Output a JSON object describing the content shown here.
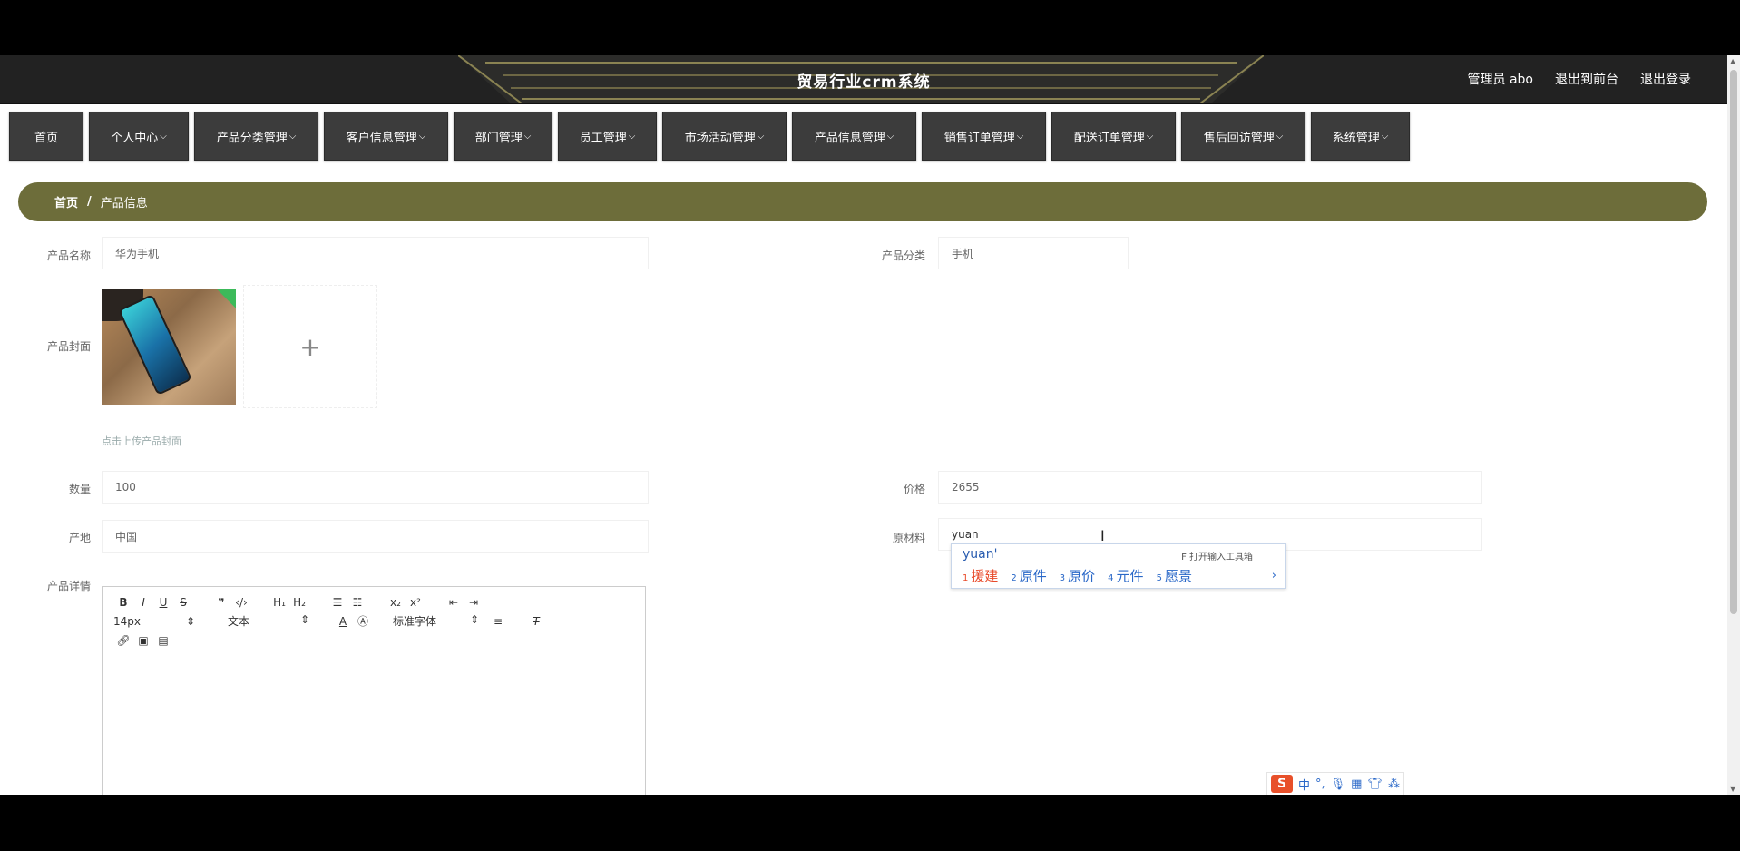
{
  "header": {
    "title": "贸易行业crm系统",
    "user_label": "管理员 abo",
    "back_to_front": "退出到前台",
    "logout": "退出登录"
  },
  "nav": [
    {
      "label": "首页",
      "has_dropdown": false
    },
    {
      "label": "个人中心",
      "has_dropdown": true
    },
    {
      "label": "产品分类管理",
      "has_dropdown": true
    },
    {
      "label": "客户信息管理",
      "has_dropdown": true
    },
    {
      "label": "部门管理",
      "has_dropdown": true
    },
    {
      "label": "员工管理",
      "has_dropdown": true
    },
    {
      "label": "市场活动管理",
      "has_dropdown": true
    },
    {
      "label": "产品信息管理",
      "has_dropdown": true
    },
    {
      "label": "销售订单管理",
      "has_dropdown": true
    },
    {
      "label": "配送订单管理",
      "has_dropdown": true
    },
    {
      "label": "售后回访管理",
      "has_dropdown": true
    },
    {
      "label": "系统管理",
      "has_dropdown": true
    }
  ],
  "breadcrumb": {
    "home": "首页",
    "separator": "/",
    "current": "产品信息"
  },
  "form": {
    "name_label": "产品名称",
    "name_value": "华为手机",
    "category_label": "产品分类",
    "category_value": "手机",
    "cover_label": "产品封面",
    "cover_hint": "点击上传产品封面",
    "quantity_label": "数量",
    "quantity_value": "100",
    "price_label": "价格",
    "price_value": "2655",
    "origin_label": "产地",
    "origin_value": "中国",
    "material_label": "原材料",
    "material_value": "yuan",
    "detail_label": "产品详情"
  },
  "editor": {
    "font_size": "14px",
    "block_format": "文本",
    "font_family": "标准字体"
  },
  "ime": {
    "composition": "yuan'",
    "hint": "F 打开输入工具箱",
    "candidates": [
      "援建",
      "原件",
      "原价",
      "元件",
      "愿景"
    ],
    "bar_logo": "S",
    "bar_mode": "中"
  },
  "colors": {
    "accent": "#6d6d3a",
    "nav_bg": "#3c3c3c",
    "header_bg": "#222222"
  }
}
